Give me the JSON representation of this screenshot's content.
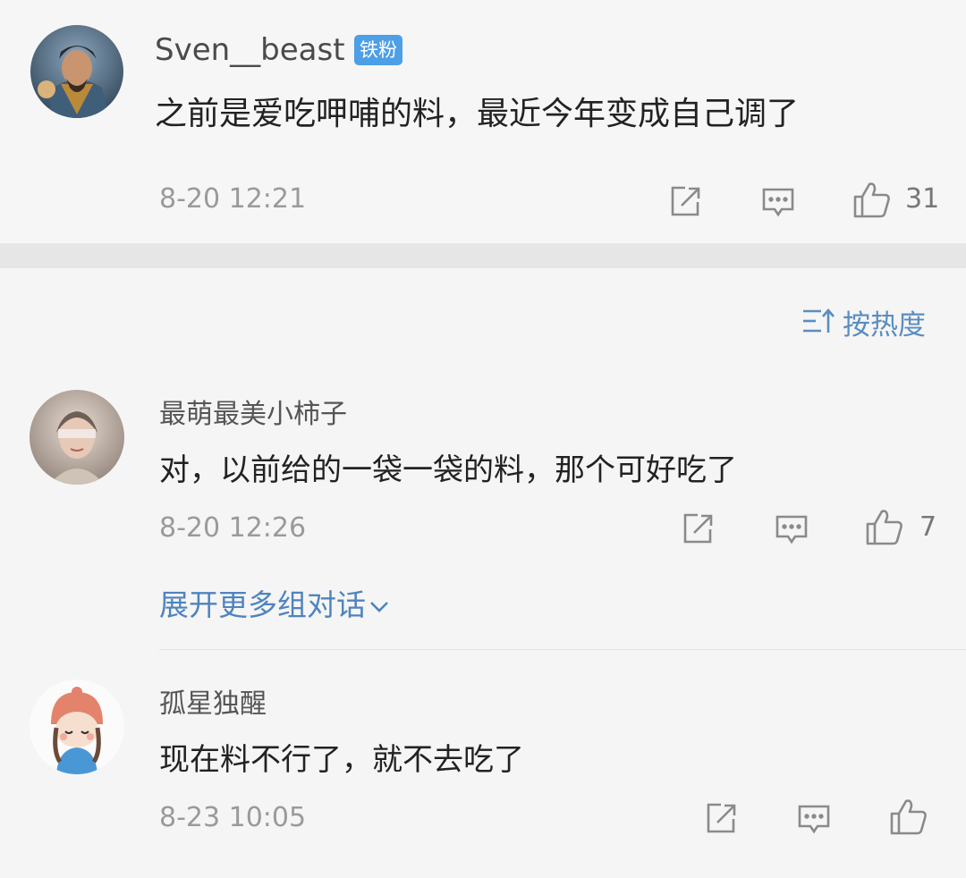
{
  "top_post": {
    "username": "Sven__beast",
    "badge": "铁粉",
    "content": "之前是爱吃呷哺的料，最近今年变成自己调了",
    "time": "8-20 12:21",
    "like_count": "31"
  },
  "sort": {
    "label": "按热度"
  },
  "comments": [
    {
      "username": "最萌最美小柿子",
      "content": "对，以前给的一袋一袋的料，那个可好吃了",
      "time": "8-20 12:26",
      "like_count": "7"
    },
    {
      "username": "孤星独醒",
      "content": "现在料不行了，就不去吃了",
      "time": "8-23 10:05",
      "like_count": ""
    }
  ],
  "expand_label": "展开更多组对话",
  "colors": {
    "accent": "#4f84bd",
    "badge": "#4d9fe6",
    "background": "#f5f5f5"
  },
  "icons": [
    "share-icon",
    "comment-icon",
    "like-icon",
    "sort-icon",
    "chevron-down-icon"
  ]
}
